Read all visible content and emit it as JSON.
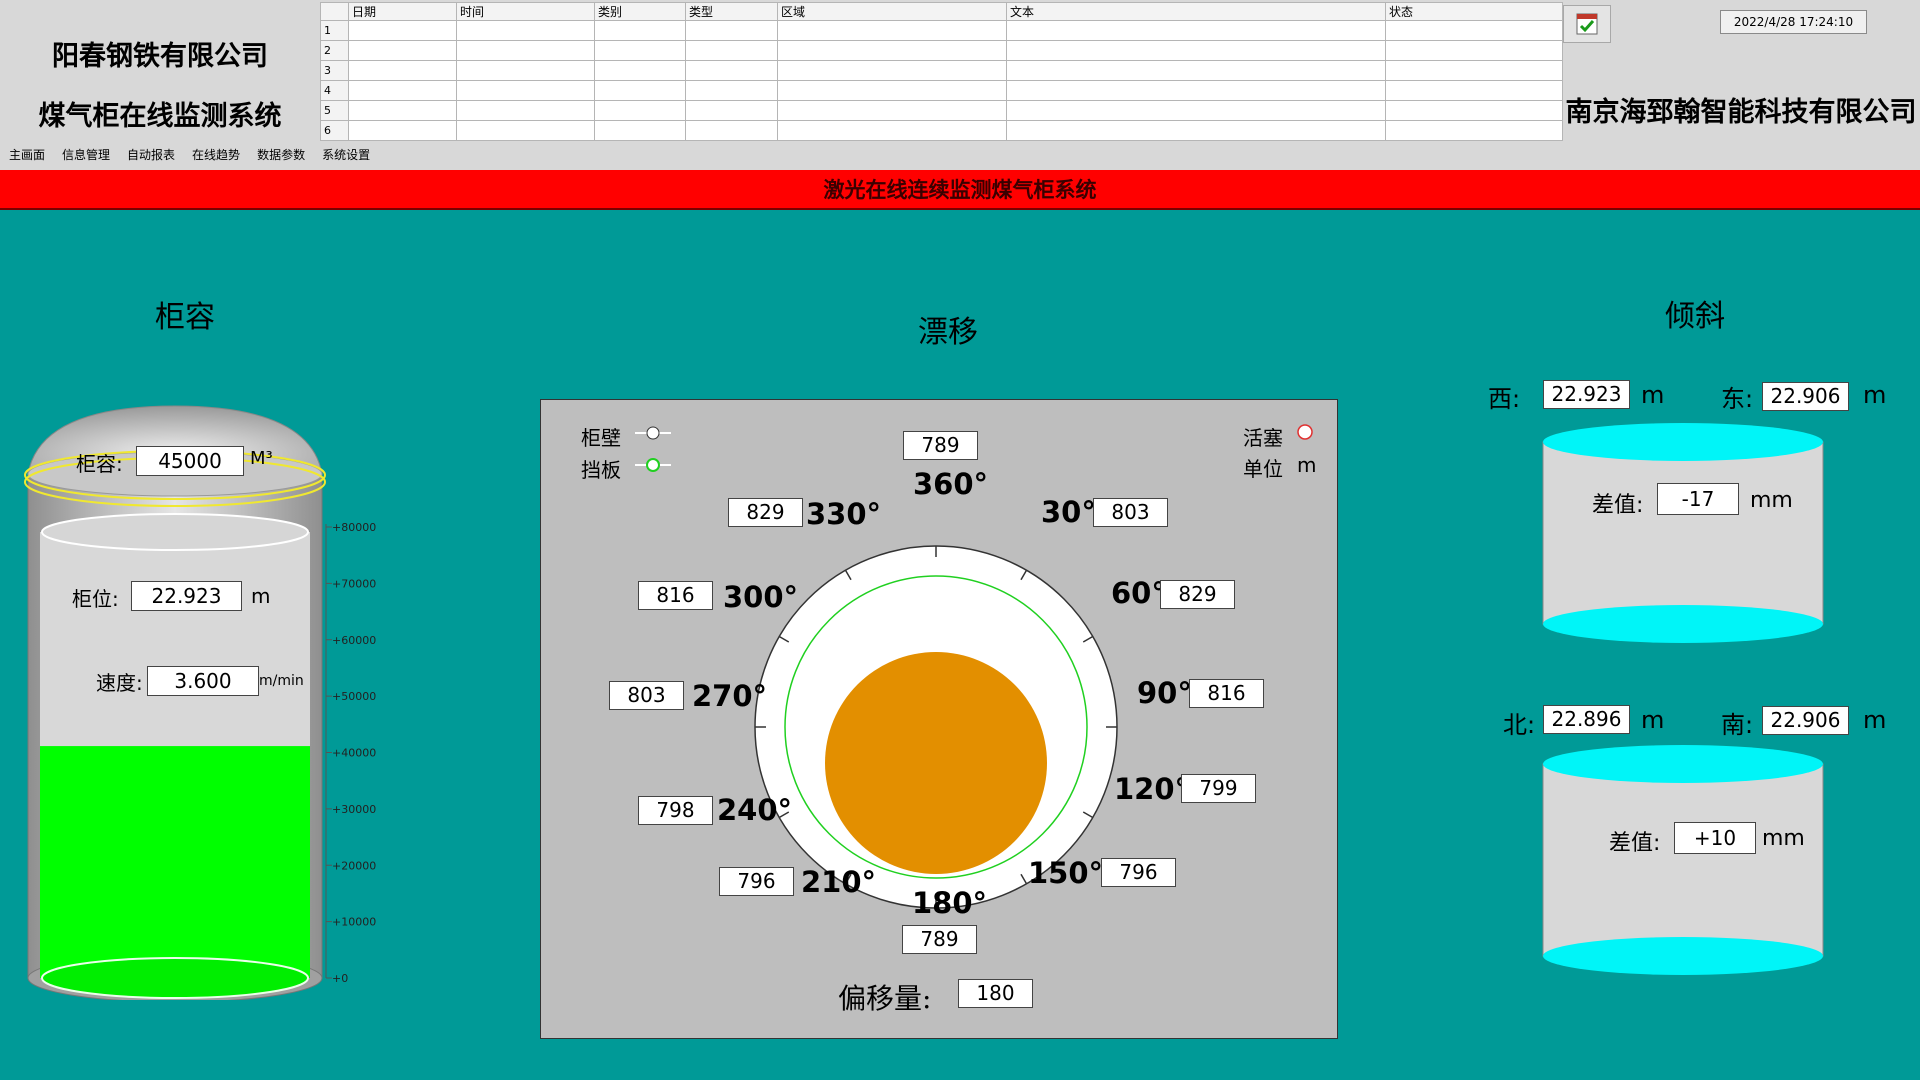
{
  "header": {
    "company": "阳春钢铁有限公司",
    "system_name": "煤气柜在线监测系统",
    "vendor": "南京海郅翰智能科技有限公司",
    "datetime": "2022/4/28 17:24:10",
    "event_table": {
      "columns": [
        "日期",
        "时间",
        "类别",
        "类型",
        "区域",
        "文本",
        "状态"
      ],
      "row_numbers": [
        "1",
        "2",
        "3",
        "4",
        "5",
        "6"
      ]
    },
    "alarm_ack_icon": "alarm-acknowledge-icon"
  },
  "menu": [
    "主画面",
    "信息管理",
    "自动报表",
    "在线趋势",
    "数据参数",
    "系统设置"
  ],
  "banner": "激光在线连续监测煤气柜系统",
  "capacity": {
    "title": "柜容",
    "volume_label": "柜容:",
    "volume_value": "45000",
    "volume_unit": "M³",
    "level_label": "柜位:",
    "level_value": "22.923",
    "level_unit": "m",
    "speed_label": "速度:",
    "speed_value": "3.600",
    "speed_unit": "m/min",
    "fill_fraction": 0.52,
    "fill_color": "#00ff00",
    "scale_ticks": [
      "+80000",
      "+70000",
      "+60000",
      "+50000",
      "+40000",
      "+30000",
      "+20000",
      "+10000",
      "+0"
    ]
  },
  "drift": {
    "title": "漂移",
    "legend": {
      "wall": "柜壁",
      "baffle": "挡板",
      "piston": "活塞",
      "unit_label": "单位",
      "unit": "m"
    },
    "angles": [
      {
        "label": "360°",
        "value": "789"
      },
      {
        "label": "30°",
        "value": "803"
      },
      {
        "label": "60°",
        "value": "829"
      },
      {
        "label": "90°",
        "value": "816"
      },
      {
        "label": "120°",
        "value": "799"
      },
      {
        "label": "150°",
        "value": "796"
      },
      {
        "label": "180°",
        "value": "789"
      },
      {
        "label": "210°",
        "value": "796"
      },
      {
        "label": "240°",
        "value": "798"
      },
      {
        "label": "270°",
        "value": "803"
      },
      {
        "label": "300°",
        "value": "816"
      },
      {
        "label": "330°",
        "value": "829"
      }
    ],
    "offset_label": "偏移量:",
    "offset_value": "180",
    "piston_color": "#e38f00",
    "baffle_color": "#20d020"
  },
  "tilt": {
    "title": "倾斜",
    "west_label": "西:",
    "west_value": "22.923",
    "east_label": "东:",
    "east_value": "22.906",
    "north_label": "北:",
    "north_value": "22.896",
    "south_label": "南:",
    "south_value": "22.906",
    "unit_m": "m",
    "diff_label": "差值:",
    "diff_we": "-17",
    "diff_ns": "+10",
    "unit_mm": "mm",
    "cylinder_color": "#00f5f8"
  }
}
